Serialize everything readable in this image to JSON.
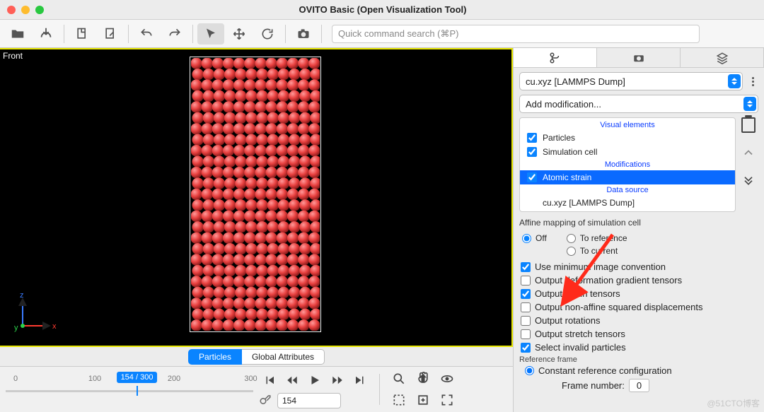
{
  "window": {
    "title": "OVITO Basic (Open Visualization Tool)"
  },
  "toolbar": {
    "search_placeholder": "Quick command search (⌘P)"
  },
  "viewport": {
    "label": "Front",
    "axes": {
      "x": "x",
      "y": "y",
      "z": "z"
    }
  },
  "tabs": {
    "particles": "Particles",
    "global": "Global Attributes"
  },
  "timeline": {
    "ticks": [
      "0",
      "100",
      "200",
      "300"
    ],
    "marker": "154 / 300",
    "spin_value": "154"
  },
  "pipeline": {
    "source_select": "cu.xyz [LAMMPS Dump]",
    "add_mod": "Add modification...",
    "sections": {
      "visual": "Visual elements",
      "mods": "Modifications",
      "data": "Data source"
    },
    "items": {
      "particles": "Particles",
      "simcell": "Simulation cell",
      "atomic_strain": "Atomic strain",
      "ds_file": "cu.xyz [LAMMPS Dump]"
    }
  },
  "props": {
    "affine_title": "Affine mapping of simulation cell",
    "radios": {
      "off": "Off",
      "to_ref": "To reference",
      "to_cur": "To current"
    },
    "checks": {
      "min_image": "Use minimum image convention",
      "def_grad": "Output deformation gradient tensors",
      "strain": "Output strain tensors",
      "nonaffine": "Output non-affine squared displacements",
      "rotations": "Output rotations",
      "stretch": "Output stretch tensors",
      "invalid": "Select invalid particles"
    },
    "ref_title": "Reference frame",
    "ref_const": "Constant reference configuration",
    "frame_label": "Frame number:",
    "frame_value": "0"
  },
  "watermark": "@51CTO博客"
}
